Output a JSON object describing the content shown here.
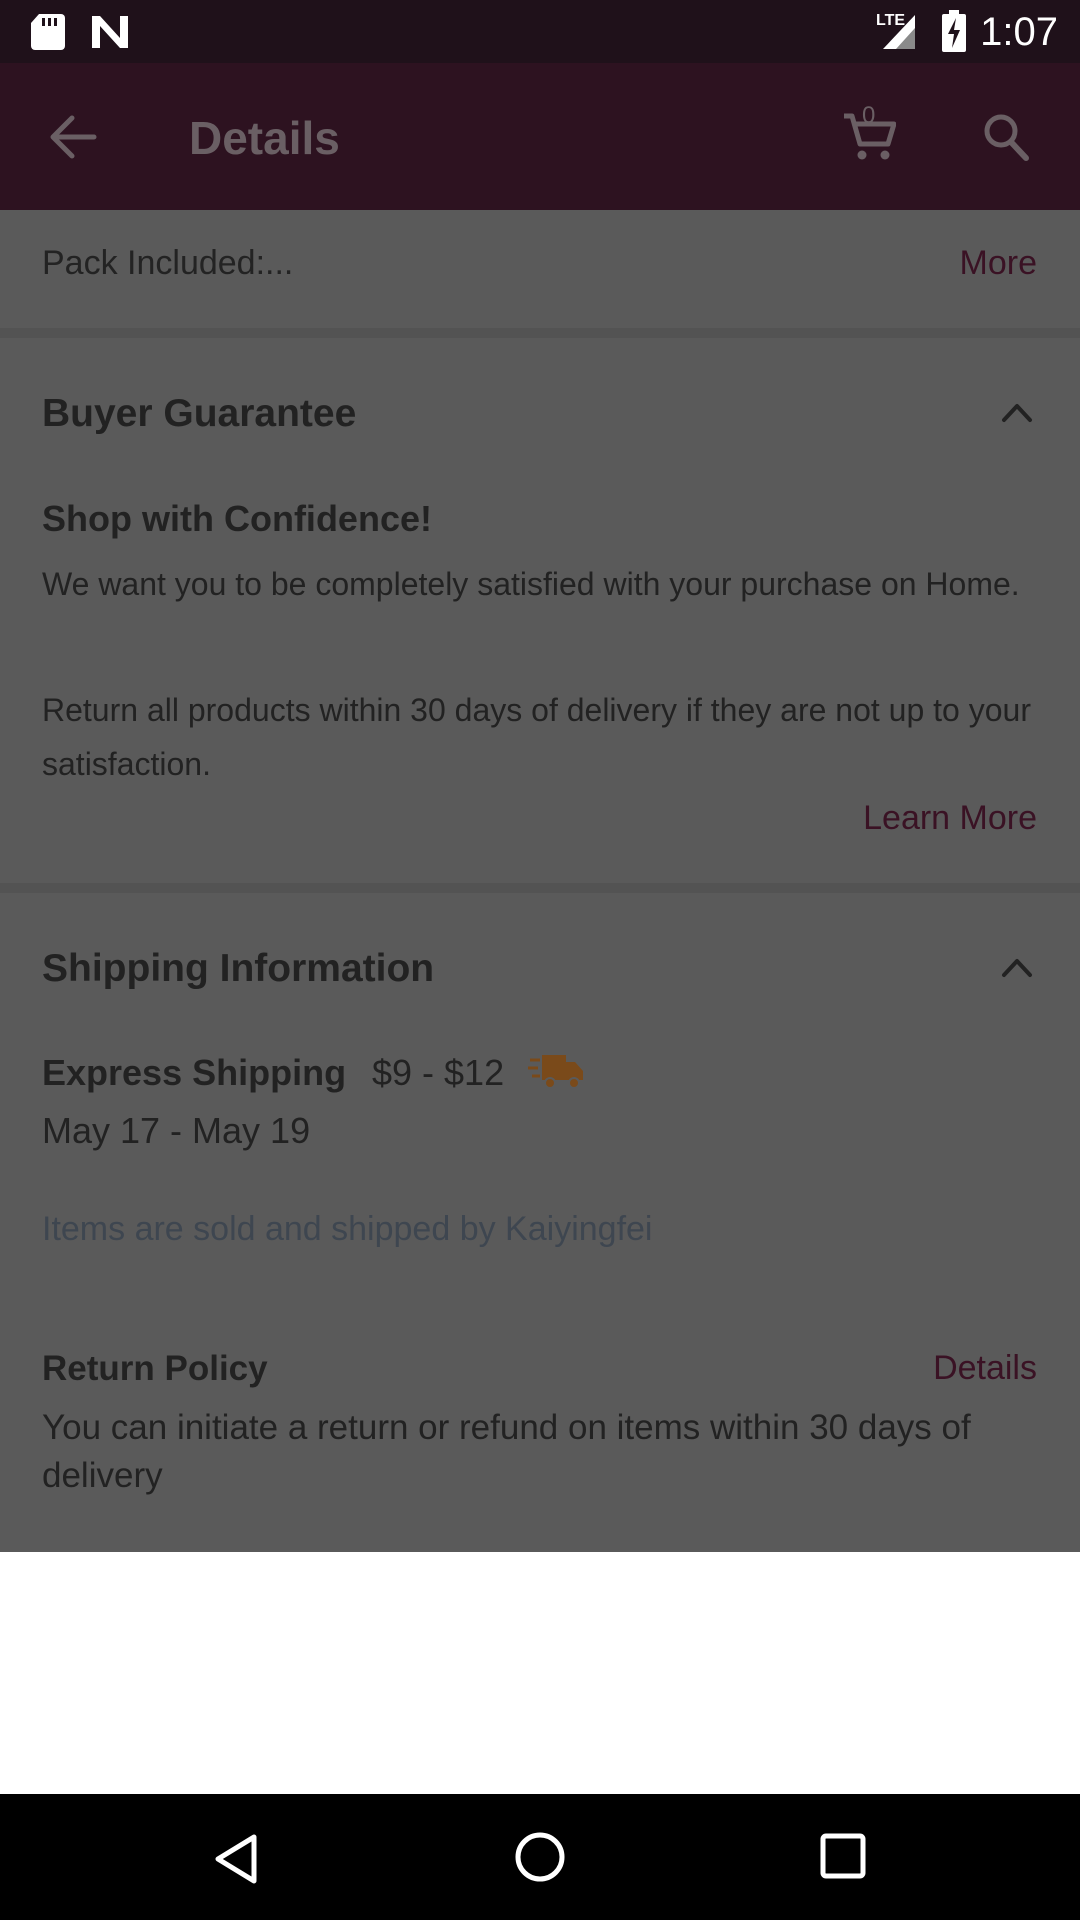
{
  "status_bar": {
    "time": "1:07",
    "network_label": "LTE",
    "icons": [
      "sd-card-icon",
      "n-notification-icon",
      "signal-icon",
      "battery-charging-icon"
    ]
  },
  "app_bar": {
    "title": "Details",
    "cart_count": "0",
    "icons": [
      "back-arrow-icon",
      "cart-icon",
      "search-icon"
    ]
  },
  "pack_row": {
    "text": "Pack Included:...",
    "more_label": "More"
  },
  "buyer_guarantee": {
    "heading": "Buyer Guarantee",
    "subheading": "Shop with Confidence!",
    "paragraph1": "We want you to be completely satisfied with your purchase on Home.",
    "paragraph2": "Return all products within 30 days of delivery if they are not up to your satisfaction.",
    "learn_more_label": "Learn More"
  },
  "shipping": {
    "heading": "Shipping Information",
    "method": "Express Shipping",
    "price": "$9 - $12",
    "dates": "May 17 - May 19",
    "sold_by": "Items are sold and shipped by Kaiyingfei",
    "truck_color": "#7a4a1a"
  },
  "return_policy": {
    "heading": "Return Policy",
    "details_label": "Details",
    "text": "You can initiate a return or refund on items within 30 days of delivery"
  },
  "nav_bar": {
    "icons": [
      "nav-back-icon",
      "nav-home-icon",
      "nav-recents-icon"
    ]
  },
  "colors": {
    "status_bar": "#1f111a",
    "app_bar": "#2d1220",
    "overlay_content": "#5a5a5a",
    "link": "#3a1224"
  }
}
